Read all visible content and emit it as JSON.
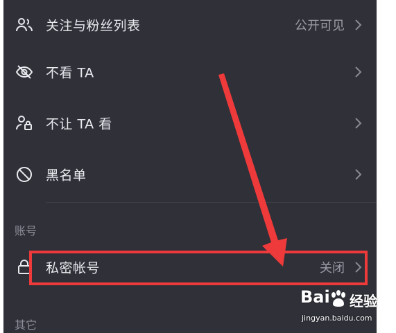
{
  "rows": [
    {
      "icon": "users-icon",
      "label": "关注与粉丝列表",
      "value": "公开可见"
    },
    {
      "icon": "eye-off-icon",
      "label": "不看 TA",
      "value": ""
    },
    {
      "icon": "user-lock-icon",
      "label": "不让 TA 看",
      "value": ""
    },
    {
      "icon": "block-icon",
      "label": "黑名单",
      "value": ""
    }
  ],
  "account_section": {
    "title": "账号",
    "private_account": {
      "icon": "lock-icon",
      "label": "私密帐号",
      "value": "关闭"
    }
  },
  "other_section": {
    "title": "其它"
  },
  "watermark": {
    "logo": "Bai",
    "jingyan": "经验",
    "url": "jingyan.baidu.com"
  },
  "colors": {
    "background": "#2f3038",
    "text": "#e9e9ee",
    "muted": "#9c9ca6",
    "highlight": "#ee3a3a"
  }
}
